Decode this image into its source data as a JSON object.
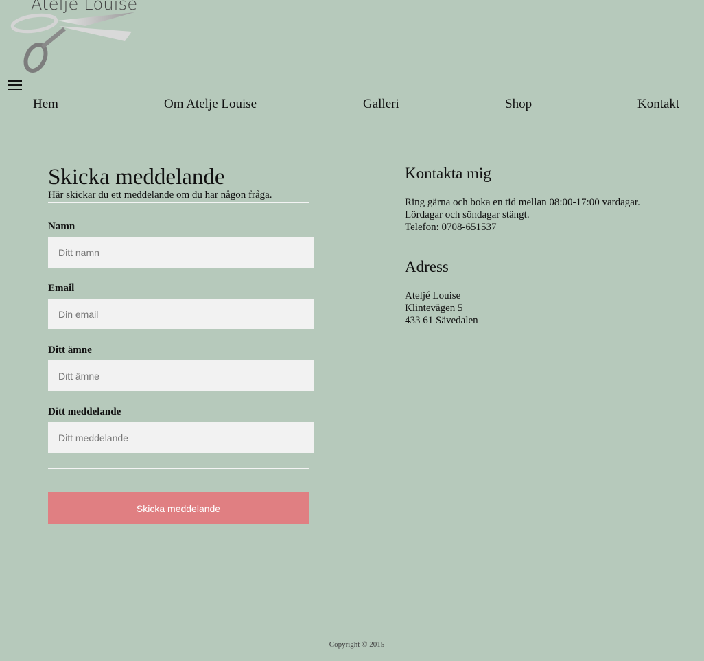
{
  "brand": {
    "name": "Ateljé Louise"
  },
  "nav": {
    "menu_icon": "hamburger-menu-icon",
    "items": [
      "Hem",
      "Om Atelje Louise",
      "Galleri",
      "Shop",
      "Kontakt"
    ]
  },
  "form": {
    "title": "Skicka meddelande",
    "subtitle": "Här skickar du ett meddelande om du har någon fråga.",
    "fields": [
      {
        "label": "Namn",
        "placeholder": "Ditt namn",
        "value": ""
      },
      {
        "label": "Email",
        "placeholder": "Din email",
        "value": ""
      },
      {
        "label": "Ditt ämne",
        "placeholder": "Ditt ämne",
        "value": ""
      },
      {
        "label": "Ditt meddelande",
        "placeholder": "Ditt meddelande",
        "value": ""
      }
    ],
    "submit_label": "Skicka meddelande"
  },
  "contact": {
    "title": "Kontakta mig",
    "lines": [
      "Ring gärna och boka en tid mellan 08:00-17:00 vardagar.",
      "Lördagar och söndagar stängt.",
      "Telefon: 0708-651537"
    ]
  },
  "address": {
    "title": "Adress",
    "lines": [
      "Ateljé Louise",
      "Klintevägen 5",
      "433 61 Sävedalen"
    ]
  },
  "footer": {
    "copyright": "Copyright © 2015"
  },
  "colors": {
    "background": "#b6c9bb",
    "input_background": "#f2f2f2",
    "button": "#e07f82",
    "rule": "#f4f4f4"
  }
}
